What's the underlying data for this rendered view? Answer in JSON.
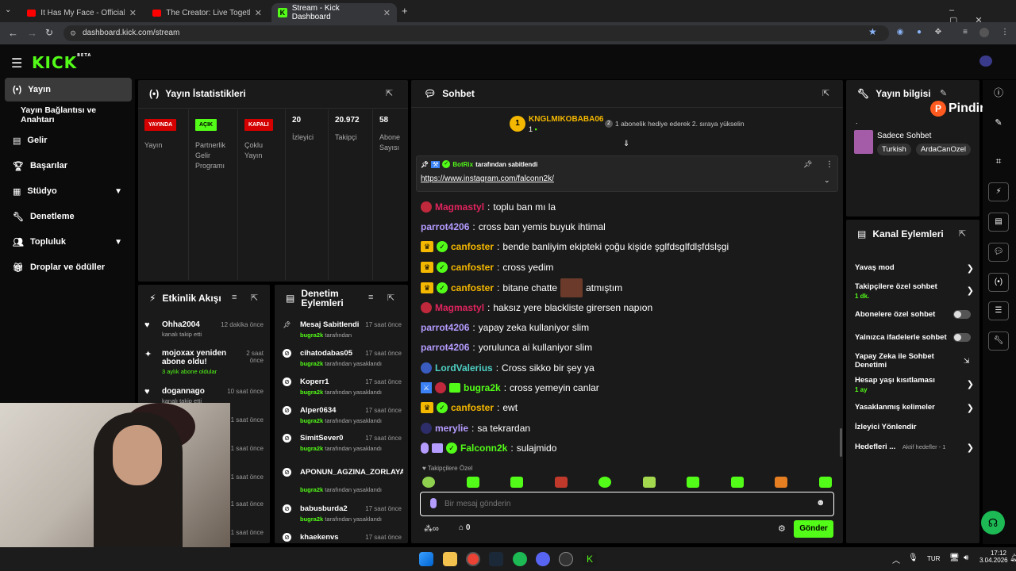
{
  "browser": {
    "tabs": [
      {
        "title": "It Has My Face - Official Version"
      },
      {
        "title": "The Creator: Live Together - Offi"
      },
      {
        "title": "Stream - Kick Dashboard"
      }
    ],
    "url": "dashboard.kick.com/stream"
  },
  "header": {
    "logo": "KICK",
    "beta": "BETA"
  },
  "sidebar": {
    "items": [
      {
        "label": "Yayın"
      },
      {
        "label": "Yayın Bağlantısı ve Anahtarı"
      },
      {
        "label": "Gelir"
      },
      {
        "label": "Başarılar"
      },
      {
        "label": "Stüdyo"
      },
      {
        "label": "Denetleme"
      },
      {
        "label": "Topluluk"
      },
      {
        "label": "Droplar ve ödüller"
      }
    ]
  },
  "stats": {
    "title": "Yayın İstatistikleri",
    "cols": [
      {
        "badge": "YAYINDA",
        "label": "Yayın"
      },
      {
        "badge": "AÇIK",
        "label": "Partnerlik Gelir Programı"
      },
      {
        "badge": "KAPALI",
        "label": "Çoklu Yayın"
      },
      {
        "value": "20",
        "label": "İzleyici"
      },
      {
        "value": "20.972",
        "label": "Takipçi"
      },
      {
        "value": "58",
        "label": "Abone Sayısı"
      }
    ]
  },
  "activity": {
    "title": "Etkinlik Akışı",
    "items": [
      {
        "name": "Ohha2004",
        "time": "12 dakika önce",
        "sub": "kanalı takip etti"
      },
      {
        "name": "mojoxax yeniden abone oldu!",
        "time": "2 saat önce",
        "sub": "3 aylık abone oldular"
      },
      {
        "name": "dogannago",
        "time": "10 saat önce",
        "sub": "kanalı takip etti"
      },
      {
        "time": "1 saat önce"
      },
      {
        "time": "1 saat önce"
      },
      {
        "time": "1 saat önce"
      },
      {
        "time": "1 saat önce"
      },
      {
        "time": "1 saat önce"
      }
    ]
  },
  "moderation": {
    "title": "Denetim Eylemleri",
    "items": [
      {
        "name": "Mesaj Sabitlendi",
        "time": "17 saat önce",
        "by": "bugra2k",
        "sub": "tarafından"
      },
      {
        "name": "cihatodabas05",
        "time": "17 saat önce",
        "by": "bugra2k",
        "sub": "tarafından yasaklandı"
      },
      {
        "name": "Koperr1",
        "time": "17 saat önce",
        "by": "bugra2k",
        "sub": "tarafından yasaklandı"
      },
      {
        "name": "Alper0634",
        "time": "17 saat önce",
        "by": "bugra2k",
        "sub": "tarafından yasaklandı"
      },
      {
        "name": "SimitSever0",
        "time": "17 saat önce",
        "by": "bugra2k",
        "sub": "tarafından yasaklandı"
      },
      {
        "name": "APONUN_AGZINA_ZORLAYA",
        "time": "",
        "by": "bugra2k",
        "sub": "tarafından yasaklandı"
      },
      {
        "name": "babusburda2",
        "time": "17 saat önce",
        "by": "bugra2k",
        "sub": "tarafından yasaklandı"
      },
      {
        "name": "khaekenvs",
        "time": "17 saat önce"
      }
    ]
  },
  "chat": {
    "title": "Sohbet",
    "top_gifter": {
      "rank": "1",
      "name": "KNGLMIKOBABA06",
      "count": "1",
      "hint_rank": "2",
      "hint": "1 abonelik hediye ederek 2. sıraya yükselin"
    },
    "pinned": {
      "by_user": "BotRix",
      "by_text": "tarafından sabitlendi",
      "link": "https://www.instagram.com/falconn2k/"
    },
    "messages": [
      {
        "user": "Magmastyl",
        "text": "toplu ban mı la",
        "color": "#e0245e"
      },
      {
        "user": "parrot4206",
        "text": "cross ban yemis buyuk ihtimal",
        "color": "#b59cff"
      },
      {
        "user": "canfoster",
        "text": "bende banliyim ekipteki çoğu kişide şglfdsglfdlşfdslşgi",
        "color": "#f5b800"
      },
      {
        "user": "canfoster",
        "text": "cross yedim",
        "color": "#f5b800"
      },
      {
        "user": "canfoster",
        "text": "bitane chatte",
        "text2": "atmıştım",
        "color": "#f5b800"
      },
      {
        "user": "Magmastyl",
        "text": "haksız yere blackliste girersen napıon",
        "color": "#e0245e"
      },
      {
        "user": "parrot4206",
        "text": "yapay zeka kullaniyor slim",
        "color": "#b59cff"
      },
      {
        "user": "parrot4206",
        "text": "yorulunca ai kullaniyor slim",
        "color": "#b59cff"
      },
      {
        "user": "LordValerius",
        "text": "Cross sikko bir şey ya",
        "color": "#4fd1c5"
      },
      {
        "user": "bugra2k",
        "text": "cross yemeyin canlar",
        "color": "#53fc18"
      },
      {
        "user": "canfoster",
        "text": "ewt",
        "color": "#f5b800"
      },
      {
        "user": "merylie",
        "text": "sa tekrardan",
        "color": "#b59cff"
      },
      {
        "user": "Falconn2k",
        "text": "sulajmido",
        "color": "#53fc18"
      }
    ],
    "followers_only": "Takipçilere Özel",
    "input_placeholder": "Bir mesaj gönderin",
    "counter": "0",
    "send_label": "Gönder"
  },
  "stream_info": {
    "title": "Yayın bilgisi",
    "dot": ".",
    "category": "Sadece Sohbet",
    "tags": [
      "Turkish",
      "ArdaCanOzel"
    ]
  },
  "overlay": {
    "brand": "Pindirim"
  },
  "channel_actions": {
    "title": "Kanal Eylemleri",
    "items": [
      {
        "label": "Yavaş mod"
      },
      {
        "label": "Takipçilere özel sohbet",
        "sub": "1 dk."
      },
      {
        "label": "Abonelere özel sohbet"
      },
      {
        "label": "Yalnızca ifadelerle sohbet"
      },
      {
        "label": "Yapay Zeka ile Sohbet Denetimi"
      },
      {
        "label": "Hesap yaşı kısıtlaması",
        "sub": "1 ay"
      },
      {
        "label": "Yasaklanmış kelimeler"
      },
      {
        "label": "İzleyici Yönlendir"
      },
      {
        "label": "Hedefleri ...",
        "sub2": "Aktif hedefler - 1"
      }
    ]
  },
  "taskbar": {
    "lang": "TUR",
    "time": "17:12",
    "date": "3.04.2026"
  }
}
